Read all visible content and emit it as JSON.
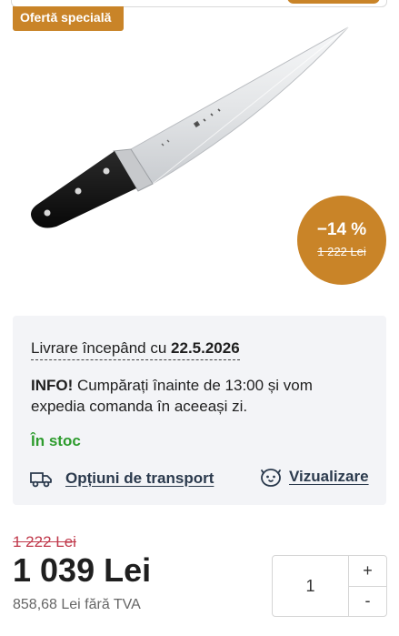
{
  "offer_badge": "Ofertă specială",
  "discount": {
    "percent": "−14 %",
    "old_price": "1 222 Lei"
  },
  "delivery": {
    "prefix": "Livrare începând cu ",
    "date": "22.5.2026"
  },
  "info": {
    "label": "INFO!",
    "text": " Cumpărați înainte de 13:00 și vom expedia comanda în aceeași zi."
  },
  "stock": "În stoc",
  "transport": {
    "label": "Opțiuni de transport",
    "icon": "truck-icon"
  },
  "view": {
    "label": "Vizualizare",
    "icon": "eye-icon"
  },
  "price": {
    "old": "1 222 Lei",
    "current": "1 039 Lei",
    "without_vat": "858,68 Lei fără TVA"
  },
  "quantity": {
    "value": "1",
    "plus": "+",
    "minus": "-"
  },
  "colors": {
    "accent": "#c98428",
    "stock_green": "#2e9c2e",
    "old_price_red": "#c0394b",
    "card_bg": "#f3f4f7"
  }
}
